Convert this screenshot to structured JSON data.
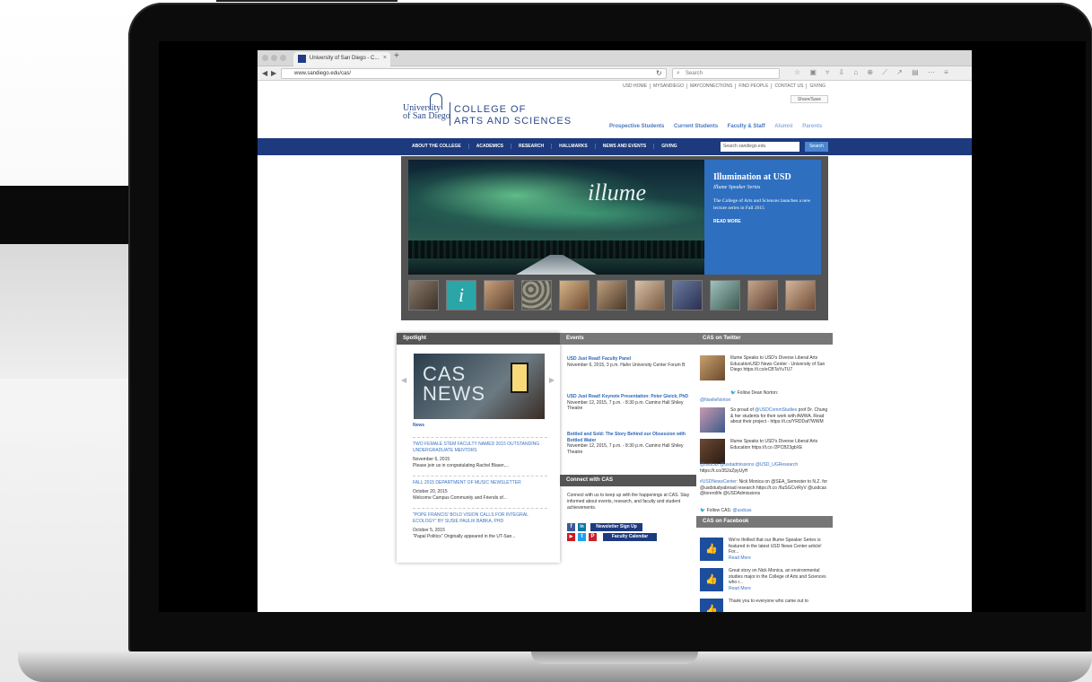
{
  "browser": {
    "tab_title": "University of San Diego - C...",
    "tab_close": "×",
    "new_tab": "+",
    "url": "www.sandiego.edu/cas/",
    "search_placeholder": "Search",
    "toolbar_icons": "☆ ▣ ▿ ⇩ ⌂ ⊕ ⟋ ↗ ▤ ⋯ ≡"
  },
  "site": {
    "utility_links": [
      "USD HOME",
      "MYSANDIEGO",
      "MAYCONNECTIONS",
      "FIND PEOPLE",
      "CONTACT US",
      "GIVING"
    ],
    "share_label": "Share/Save",
    "logo_line1": "University",
    "logo_line2": "of San Diego",
    "college_line1": "COLLEGE OF",
    "college_line2": "ARTS AND SCIENCES",
    "audience_nav": [
      "Prospective Students",
      "Current Students",
      "Faculty & Staff",
      "Alumni",
      "Parents"
    ],
    "main_nav": [
      "ABOUT THE COLLEGE",
      "ACADEMICS",
      "RESEARCH",
      "HALLMARKS",
      "NEWS AND EVENTS",
      "GIVING"
    ],
    "search_placeholder": "Search sandiego.edu",
    "search_button": "Search"
  },
  "hero": {
    "script_text": "illume",
    "panel_title": "Illumination at USD",
    "panel_subtitle": "Illume Speaker Series",
    "panel_desc": "The College of Arts and Sciences launches a new lecture series in Fall 2015",
    "panel_more": "READ MORE",
    "active_thumb_letter": "i"
  },
  "spotlight": {
    "header": "Spotlight",
    "news_word1": "CAS",
    "news_word2": "NEWS",
    "section": "News",
    "items": [
      {
        "title": "TWO FEMALE STEM FACULTY NAMED 2015 OUTSTANDING UNDERGRADUATE MENTORS",
        "date": "November 6, 2015",
        "excerpt": "Please join us in congratulating Rachel Blaser,..."
      },
      {
        "title": "FALL 2015 DEPARTMENT OF MUSIC NEWSLETTER",
        "date": "October 20, 2015",
        "excerpt": "Welcome Campus Community and Friends of..."
      },
      {
        "title": "\"POPE FRANCIS' BOLD VISION CALLS FOR INTEGRAL ECOLOGY\" BY SUSIE PAULIK BABKA, PHD",
        "date": "October 5, 2015",
        "excerpt": "\"Papal Politics\" Originally appeared in the UT-San..."
      }
    ]
  },
  "events": {
    "header": "Events",
    "items": [
      {
        "title": "USD Just Read! Faculty Panel",
        "detail": "November 6, 2015, 3 p.m. Hahn University Center Forum B"
      },
      {
        "title": "USD Just Read! Keynote Presentation: Peter Gleick, PhD",
        "detail": "November 12, 2015, 7 p.m. - 8:30 p.m. Camino Hall Shiley Theatre"
      },
      {
        "title": "Bottled and Sold: The Story Behind our Obsession with Bottled Water",
        "detail": "November 12, 2015, 7 p.m. - 8:30 p.m. Camino Hall Shiley Theatre"
      }
    ]
  },
  "connect": {
    "header": "Connect with CAS",
    "text": "Connect with us to keep up with the happenings at CAS. Stay informed about events, research, and faculty and student achievements.",
    "newsletter_button": "Newsletter Sign Up",
    "calendar_button": "Faculty Calendar",
    "social": [
      "f",
      "in",
      "▶",
      "t",
      "P"
    ]
  },
  "twitter": {
    "header": "CAS on Twitter",
    "tweet1": "Illume Speaks to USD's Diverse Liberal Arts EducationUSD News Center - University of San Diego https://t.co/eCBTaYuTU7",
    "follow1": "Follow Dean Norton:",
    "handle1": "@NoelleNorton",
    "tweet2_prefix": "So proud of ",
    "tweet2_handle": "@USDCommStudies",
    "tweet2_rest": " prof Dr. Chung & her students for their work with AWWA. Read about their project - https://t.co/YRDDaf7WWM",
    "tweet3": "Illume Speaks to USD's Diverse Liberal Arts Education https://t.co /2PCB23gbXE",
    "tweet3_handles": "@usdcas @usdadmissions @USD_UGResearch",
    "tweet3_link": "https://t.co/352sZpyUyH",
    "tweet4_prefix": "#USDNewsCenter",
    "tweet4_rest": ": Nick Monica on @SEA_Semester to N.Z. for @usdstudyabroad research https://t.co /6uSGCvrRyV @usdcas @torerolife @USDAdmissions",
    "follow2_label": "Follow CAS:",
    "follow2_handle": "@usdcas"
  },
  "facebook": {
    "header": "CAS on Facebook",
    "posts": [
      {
        "text": "We're thrilled that our Illume Speaker Series is featured in the latest USD News Center article! For...",
        "more": "Read More"
      },
      {
        "text": "Great story on Nick Monica, an environmental studies major in the College of Arts and Sciences who r...",
        "more": "Read More"
      },
      {
        "text": "Thank you to everyone who came out to",
        "more": ""
      }
    ]
  }
}
